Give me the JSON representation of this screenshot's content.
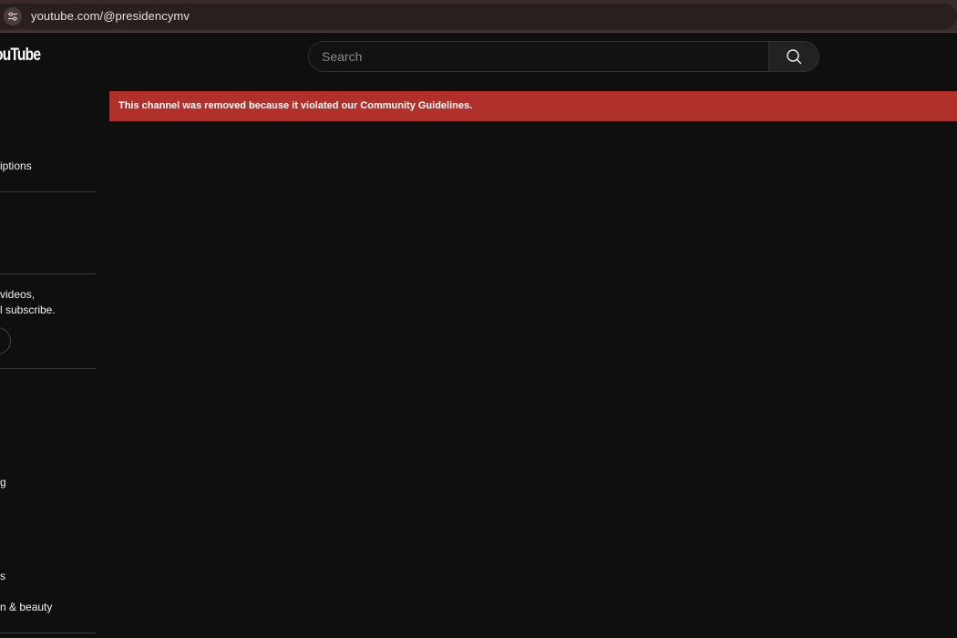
{
  "browser": {
    "url": "youtube.com/@presidencymv"
  },
  "header": {
    "logo_text": "ouTube",
    "search_placeholder": "Search"
  },
  "banner": {
    "message": "This channel was removed because it violated our Community Guidelines.",
    "color": "#b0302c"
  },
  "sidebar": {
    "subscriptions_label": "iptions",
    "signin_prompt_line1": "videos,",
    "signin_prompt_line2": "l subscribe.",
    "explore_items": [
      "g",
      "s",
      "n & beauty"
    ]
  },
  "icons": {
    "site_settings": "tune-icon",
    "search": "search-icon"
  }
}
